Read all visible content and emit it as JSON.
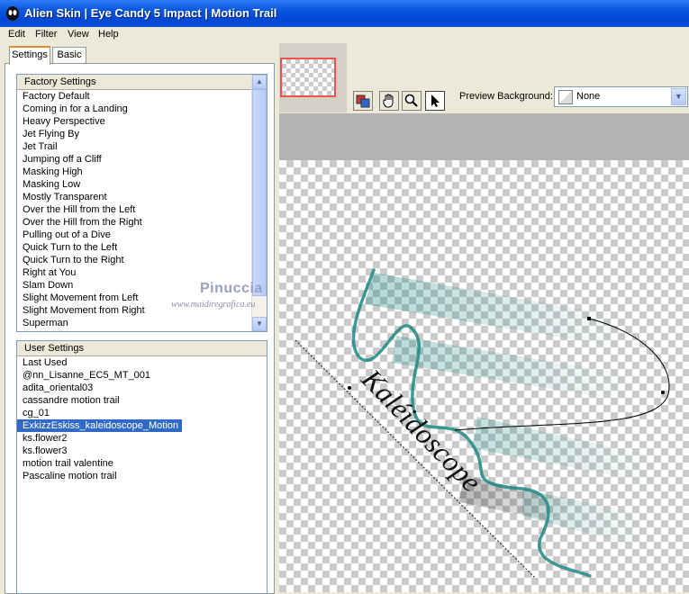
{
  "window": {
    "title": "Alien Skin  |  Eye Candy 5 Impact  |  Motion Trail"
  },
  "menu": [
    "Edit",
    "Filter",
    "View",
    "Help"
  ],
  "tabs": [
    {
      "label": "Settings",
      "active": true
    },
    {
      "label": "Basic",
      "active": false
    }
  ],
  "factory_settings": {
    "header": "Factory Settings",
    "items": [
      "Factory Default",
      "Coming in for a Landing",
      "Heavy Perspective",
      "Jet Flying By",
      "Jet Trail",
      "Jumping off a Cliff",
      "Masking High",
      "Masking Low",
      "Mostly Transparent",
      "Over the Hill from the Left",
      "Over the Hill from the Right",
      "Pulling out of a Dive",
      "Quick Turn to the Left",
      "Quick Turn to the Right",
      "Right at You",
      "Slam Down",
      "Slight Movement from Left",
      "Slight Movement from Right",
      "Superman"
    ]
  },
  "user_settings": {
    "header": "User Settings",
    "selected": "ExkizzEskiss_kaleidoscope_Motion",
    "items": [
      "Last Used",
      "@nn_Lisanne_EC5_MT_001",
      "adita_oriental03",
      "cassandre motion trail",
      "cg_01",
      "ExkizzEskiss_kaleidoscope_Motion",
      "ks.flower2",
      "ks.flower3",
      "motion trail valentine",
      "Pascaline motion trail"
    ]
  },
  "watermark": {
    "name": "Pinuccia",
    "url": "www.maidiregrafica.eu"
  },
  "toolbar": {
    "preview_background_label": "Preview Background:",
    "preview_background_value": "None"
  },
  "preview": {
    "text": "Kaléidoscope"
  },
  "colors": {
    "title_bar": "#0a58e0",
    "selection": "#316ac5",
    "trail": "#1e8a84",
    "nav_frame": "#f05050"
  }
}
